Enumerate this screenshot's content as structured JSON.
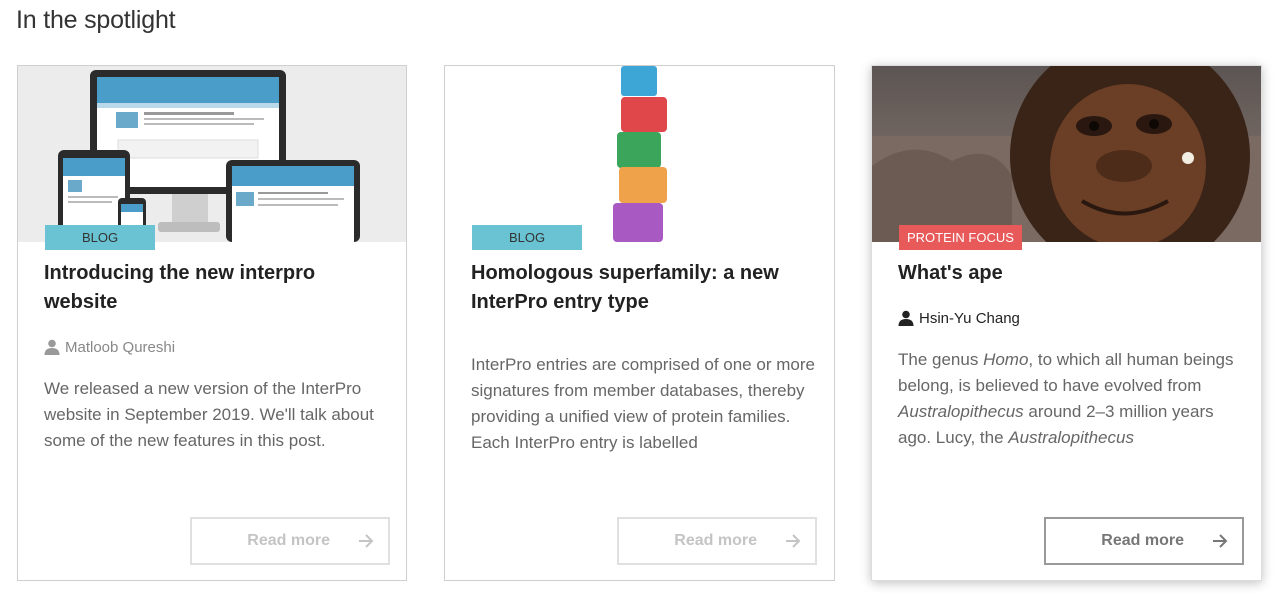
{
  "section": {
    "title": "In the spotlight"
  },
  "cards": [
    {
      "tag": "BLOG",
      "title": "Introducing the new interpro website",
      "author": "Matloob Qureshi",
      "text": "We released a new version of the InterPro website in September 2019. We'll talk about some of the new features in this post.",
      "read_more": "Read more",
      "image_icon": "devices-mockup-image"
    },
    {
      "tag": "BLOG",
      "title": "Homologous superfamily: a new InterPro entry type",
      "author": "",
      "text": "InterPro entries are comprised of one or more signatures from member databases, thereby providing a unified view of protein families. Each InterPro entry is labelled",
      "read_more": "Read more",
      "image_icon": "stacked-blocks-image"
    },
    {
      "tag": "PROTEIN FOCUS",
      "title": "What's ape",
      "author": "Hsin-Yu Chang",
      "text_parts": [
        "The genus ",
        "Homo",
        ", to which all human beings belong, is believed to have evolved from ",
        "Australopithecus",
        " around 2–3 million years ago. Lucy, the ",
        "Australopithecus"
      ],
      "read_more": "Read more",
      "image_icon": "ape-face-image"
    }
  ],
  "colors": {
    "blog_tag": "#69c3d3",
    "focus_tag": "#e85a5a"
  }
}
